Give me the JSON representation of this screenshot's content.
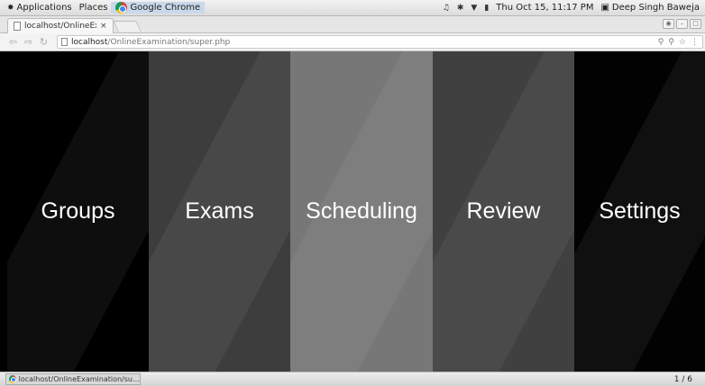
{
  "topbar": {
    "applications": "Applications",
    "places": "Places",
    "app_name": "Google Chrome",
    "datetime": "Thu Oct 15, 11:17 PM",
    "user": "Deep Singh Baweja"
  },
  "browser": {
    "tab_title": "localhost/OnlineEx…",
    "tab_close": "×",
    "url_host": "localhost",
    "url_path": "/OnlineExamination/super.php"
  },
  "menu": {
    "items": [
      {
        "label": "Groups"
      },
      {
        "label": "Exams"
      },
      {
        "label": "Scheduling"
      },
      {
        "label": "Review"
      },
      {
        "label": "Settings"
      }
    ]
  },
  "taskbar": {
    "window_title": "localhost/OnlineExamination/su…",
    "workspace": "1 / 6"
  },
  "colors": {
    "panel_1": "#000000",
    "panel_2": "#3d3d3d",
    "panel_3": "#777777",
    "panel_4": "#404040",
    "panel_5": "#020202"
  }
}
